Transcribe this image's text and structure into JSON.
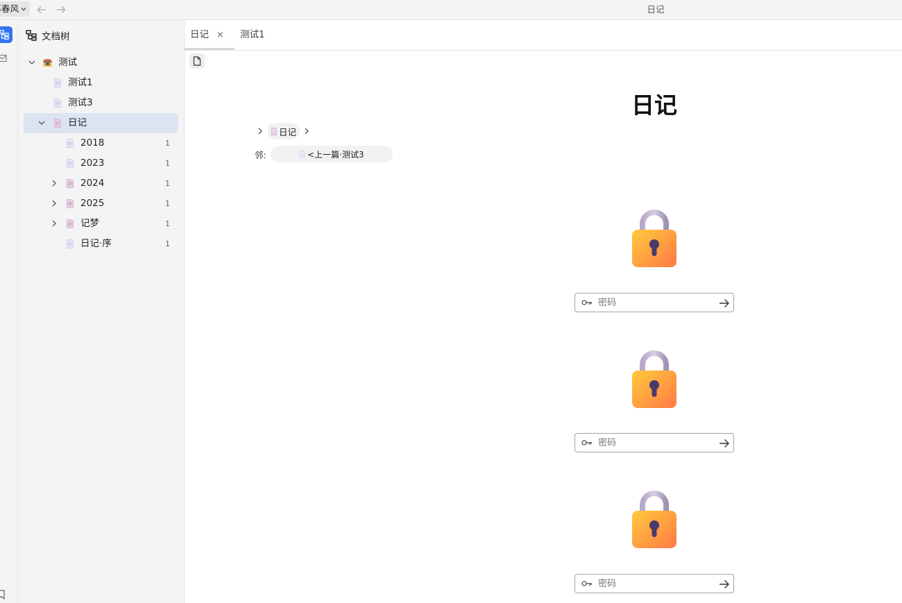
{
  "topbar": {
    "notebook_label": "暮春风",
    "window_title": "日记"
  },
  "filetree": {
    "title": "文档树",
    "items": [
      {
        "label": "测试",
        "count": ""
      },
      {
        "label": "测试1",
        "count": ""
      },
      {
        "label": "测试3",
        "count": ""
      },
      {
        "label": "日记",
        "count": ""
      },
      {
        "label": "2018",
        "count": "1"
      },
      {
        "label": "2023",
        "count": "1"
      },
      {
        "label": "2024",
        "count": "1"
      },
      {
        "label": "2025",
        "count": "1"
      },
      {
        "label": "记梦",
        "count": "1"
      },
      {
        "label": "日记·序",
        "count": "1"
      }
    ]
  },
  "tabs": [
    {
      "label": "日记",
      "close": "×"
    },
    {
      "label": "测试1"
    }
  ],
  "editor": {
    "title": "日记",
    "breadcrumb": "日记",
    "neighbor_label": "邻:",
    "neighbor_link": "<上一篇·测试3",
    "locks": [
      {
        "placeholder": "密码"
      },
      {
        "placeholder": "密码"
      },
      {
        "placeholder": "密码"
      }
    ]
  }
}
